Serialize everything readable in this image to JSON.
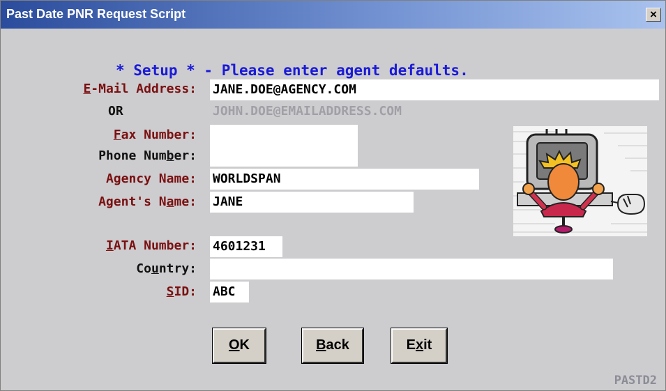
{
  "window": {
    "title": "Past Date PNR Request Script",
    "close_label": "×",
    "screen_id": "PASTD2"
  },
  "heading": "* Setup * - Please enter agent defaults.",
  "labels": {
    "email_pre": "",
    "email_acc": "E",
    "email_post": "-Mail Address:",
    "or": "OR",
    "fax_pre": "",
    "fax_acc": "F",
    "fax_post": "ax Number:",
    "phone_pre": "Phone Num",
    "phone_acc": "b",
    "phone_post": "er:",
    "agency": "Agency Name:",
    "agent_pre": "Agent's N",
    "agent_acc": "a",
    "agent_post": "me:",
    "iata_pre": "",
    "iata_acc": "I",
    "iata_post": "ATA Number:",
    "country_pre": "Co",
    "country_acc": "u",
    "country_post": "ntry:",
    "sid_pre": "",
    "sid_acc": "S",
    "sid_post": "ID:"
  },
  "fields": {
    "email": "JANE.DOE@AGENCY.COM",
    "email_hint": "JOHN.DOE@EMAILADDRESS.COM",
    "fax": "",
    "phone": "",
    "agency": "WORLDSPAN",
    "agent": "JANE",
    "iata": "4601231",
    "country": "",
    "sid": "ABC"
  },
  "buttons": {
    "ok_acc": "O",
    "ok_post": "K",
    "back_acc": "B",
    "back_post": "ack",
    "exit_pre": "E",
    "exit_acc": "x",
    "exit_post": "it"
  },
  "colors": {
    "label": "#7a1010",
    "heading": "#1a1ad8",
    "title_bar": "#2b4c9c"
  },
  "illustration": "agent-at-computer-icon"
}
